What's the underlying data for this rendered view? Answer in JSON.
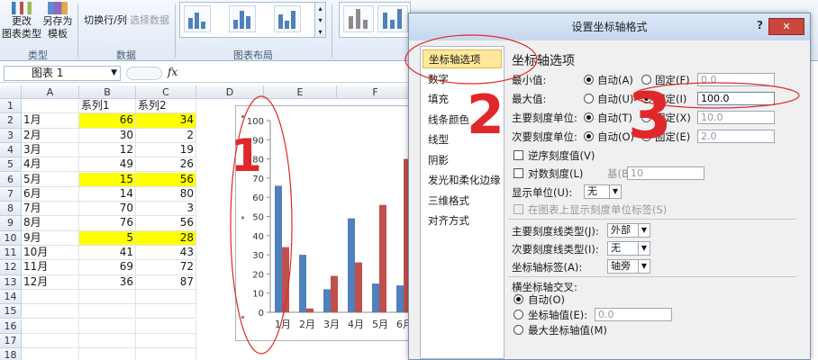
{
  "ribbon": {
    "type_group": {
      "change_type": [
        "更改",
        "图表类型"
      ],
      "save_template": [
        "另存为",
        "模板"
      ],
      "label": "类型"
    },
    "data_group": {
      "switch": "切换行/列",
      "select": "选择数据",
      "label": "数据"
    },
    "layout_group": {
      "label": "图表布局"
    }
  },
  "formula_bar": {
    "name_box": "图表 1",
    "fx": "fx"
  },
  "sheet": {
    "columns": [
      "A",
      "B",
      "C",
      "D",
      "E",
      "F"
    ],
    "rows": [
      "1",
      "2",
      "3",
      "4",
      "5",
      "6",
      "7",
      "8",
      "9",
      "10",
      "11",
      "12",
      "13",
      "14",
      "15",
      "16",
      "17",
      "18"
    ],
    "header_row": [
      "",
      "系列1",
      "系列2"
    ],
    "data": [
      {
        "month": "1月",
        "s1": "66",
        "s2": "34",
        "highlight": true
      },
      {
        "month": "2月",
        "s1": "30",
        "s2": "2",
        "highlight": false
      },
      {
        "month": "3月",
        "s1": "12",
        "s2": "19",
        "highlight": false
      },
      {
        "month": "4月",
        "s1": "49",
        "s2": "26",
        "highlight": false
      },
      {
        "month": "5月",
        "s1": "15",
        "s2": "56",
        "highlight": true
      },
      {
        "month": "6月",
        "s1": "14",
        "s2": "80",
        "highlight": false
      },
      {
        "month": "7月",
        "s1": "70",
        "s2": "3",
        "highlight": false
      },
      {
        "month": "8月",
        "s1": "76",
        "s2": "56",
        "highlight": false
      },
      {
        "month": "9月",
        "s1": "5",
        "s2": "28",
        "highlight": true
      },
      {
        "month": "10月",
        "s1": "41",
        "s2": "43",
        "highlight": false
      },
      {
        "month": "11月",
        "s1": "69",
        "s2": "72",
        "highlight": false
      },
      {
        "month": "12月",
        "s1": "36",
        "s2": "87",
        "highlight": false
      }
    ]
  },
  "chart_data": {
    "type": "bar",
    "categories": [
      "1月",
      "2月",
      "3月",
      "4月",
      "5月",
      "6月"
    ],
    "series": [
      {
        "values": [
          66,
          30,
          12,
          49,
          15,
          14
        ],
        "color": "#4f81bd"
      },
      {
        "values": [
          34,
          2,
          19,
          26,
          56,
          80
        ],
        "color": "#c0504d"
      }
    ],
    "ylim": [
      0,
      100
    ],
    "yticks": [
      "0",
      "10",
      "20",
      "30",
      "40",
      "50",
      "60",
      "70",
      "80",
      "90",
      "100"
    ]
  },
  "dialog": {
    "title": "设置坐标轴格式",
    "help": "?",
    "close": "✕",
    "nav": [
      "坐标轴选项",
      "数字",
      "填充",
      "线条颜色",
      "线型",
      "阴影",
      "发光和柔化边缘",
      "三维格式",
      "对齐方式"
    ],
    "panel_title": "坐标轴选项",
    "min": {
      "label": "最小值:",
      "auto": "自动(A)",
      "fixed": "固定(F)",
      "value": "0.0"
    },
    "max": {
      "label": "最大值:",
      "auto": "自动(U)",
      "fixed": "固定(I)",
      "value": "100.0"
    },
    "major": {
      "label": "主要刻度单位:",
      "auto": "自动(T)",
      "fixed": "固定(X)",
      "value": "10.0"
    },
    "minor": {
      "label": "次要刻度单位:",
      "auto": "自动(O)",
      "fixed": "固定(E)",
      "value": "2.0"
    },
    "reverse": "逆序刻度值(V)",
    "log": "对数刻度(L)",
    "base_label": "基(B):",
    "base_value": "10",
    "display_units_label": "显示单位(U):",
    "display_units_value": "无",
    "show_units_label": "在图表上显示刻度单位标签(S)",
    "major_tick_label": "主要刻度线类型(J):",
    "major_tick_value": "外部",
    "minor_tick_label": "次要刻度线类型(I):",
    "minor_tick_value": "无",
    "axis_labels_label": "坐标轴标签(A):",
    "axis_labels_value": "轴旁",
    "cross_title": "横坐标轴交叉:",
    "cross_auto": "自动(O)",
    "cross_value_label": "坐标轴值(E):",
    "cross_value": "0.0",
    "cross_max": "最大坐标轴值(M)"
  },
  "annotations": {
    "marks": [
      "1",
      "2",
      "3"
    ],
    "color": "#e0282b"
  }
}
